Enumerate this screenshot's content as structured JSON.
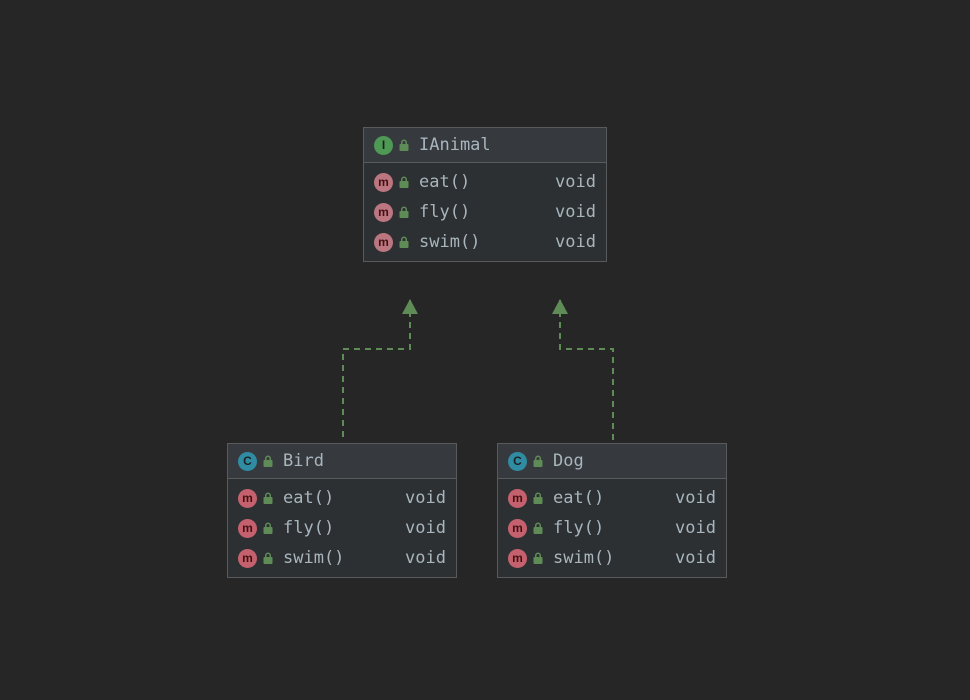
{
  "diagram": {
    "interface": {
      "badge": "I",
      "name": "IAnimal",
      "members": [
        {
          "badge": "m",
          "sig": "eat()",
          "ret": "void"
        },
        {
          "badge": "m",
          "sig": "fly()",
          "ret": "void"
        },
        {
          "badge": "m",
          "sig": "swim()",
          "ret": "void"
        }
      ]
    },
    "bird": {
      "badge": "C",
      "name": "Bird",
      "members": [
        {
          "badge": "m",
          "sig": "eat()",
          "ret": "void"
        },
        {
          "badge": "m",
          "sig": "fly()",
          "ret": "void"
        },
        {
          "badge": "m",
          "sig": "swim()",
          "ret": "void"
        }
      ]
    },
    "dog": {
      "badge": "C",
      "name": "Dog",
      "members": [
        {
          "badge": "m",
          "sig": "eat()",
          "ret": "void"
        },
        {
          "badge": "m",
          "sig": "fly()",
          "ret": "void"
        },
        {
          "badge": "m",
          "sig": "swim()",
          "ret": "void"
        }
      ]
    }
  },
  "colors": {
    "connector": "#5e8b56"
  }
}
